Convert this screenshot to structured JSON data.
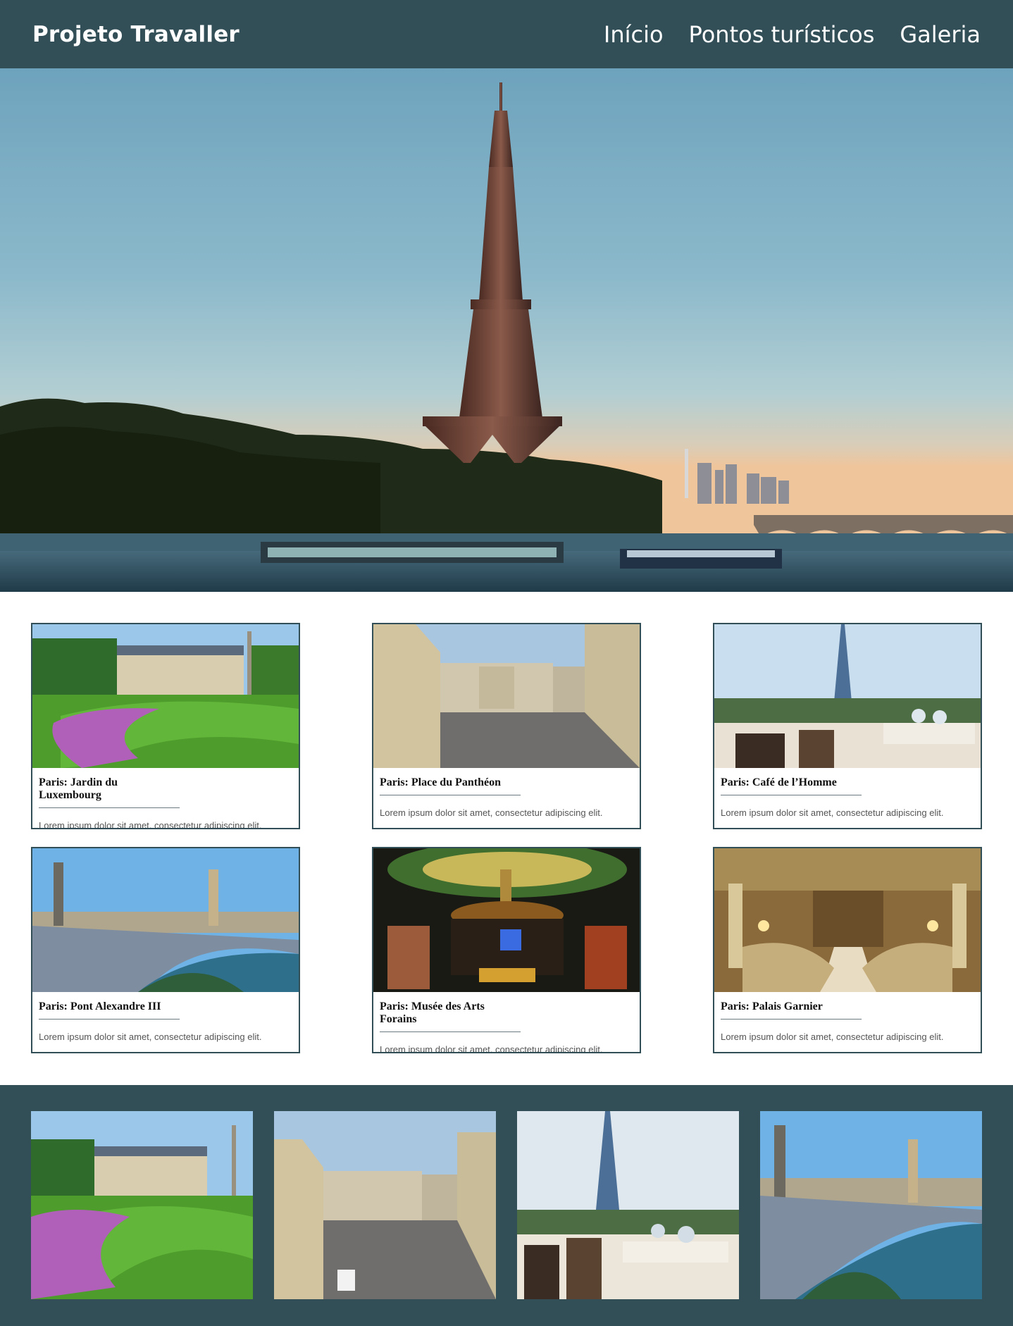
{
  "header": {
    "brand": "Projeto Travaller",
    "nav": [
      "Início",
      "Pontos turísticos",
      "Galeria"
    ]
  },
  "cards": [
    {
      "title": "Paris: Jardin du Luxembourg",
      "text": "Lorem ipsum dolor sit amet, consectetur adipiscing elit."
    },
    {
      "title": "Paris: Place du Panthéon",
      "text": "Lorem ipsum dolor sit amet, consectetur adipiscing elit."
    },
    {
      "title": "Paris: Café de l’Homme",
      "text": "Lorem ipsum dolor sit amet, consectetur adipiscing elit."
    },
    {
      "title": "Paris: Pont Alexandre III",
      "text": "Lorem ipsum dolor sit amet, consectetur adipiscing elit."
    },
    {
      "title": "Paris: Musée des Arts Forains",
      "text": "Lorem ipsum dolor sit amet, consectetur adipiscing elit."
    },
    {
      "title": "Paris: Palais Garnier",
      "text": "Lorem ipsum dolor sit amet, consectetur adipiscing elit."
    }
  ],
  "colors": {
    "header_bg": "#324f57",
    "card_border": "#324f57",
    "footer_bg": "#324f57"
  }
}
